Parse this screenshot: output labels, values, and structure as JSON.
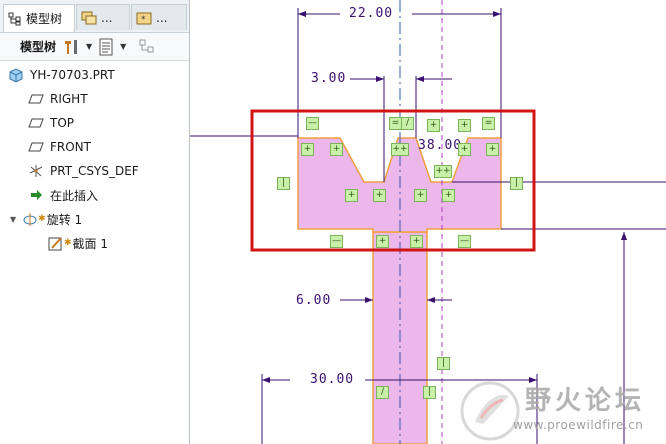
{
  "tabs": [
    {
      "label": "模型树",
      "icon": "tree-icon"
    },
    {
      "label": "...",
      "icon": "layers-icon"
    },
    {
      "label": "...",
      "icon": "folder-star-icon"
    }
  ],
  "toolbar": {
    "label": "模型树"
  },
  "tree": {
    "items": [
      {
        "label": "YH-70703.PRT",
        "icon": "part-icon"
      },
      {
        "label": "RIGHT",
        "icon": "datum-plane-icon"
      },
      {
        "label": "TOP",
        "icon": "datum-plane-icon"
      },
      {
        "label": "FRONT",
        "icon": "datum-plane-icon"
      },
      {
        "label": "PRT_CSYS_DEF",
        "icon": "csys-icon"
      },
      {
        "label": "在此插入",
        "icon": "insert-arrow-icon"
      },
      {
        "label": "旋转 1",
        "icon": "revolve-icon"
      },
      {
        "label": "截面 1",
        "icon": "sketch-icon"
      }
    ]
  },
  "dims": {
    "d1": "22.00",
    "d2": "3.00",
    "d3": "38.00",
    "d4": "6.00",
    "d5": "30.00"
  },
  "watermark": {
    "title": "野火论坛",
    "url": "www.proewildfire.cn"
  },
  "colors": {
    "sketch_fill": "#ecb8ec",
    "sketch_edge": "#f0a040",
    "dimension": "#3a1070",
    "highlight_box": "#d21414",
    "constraint": "#c9f0a8"
  }
}
